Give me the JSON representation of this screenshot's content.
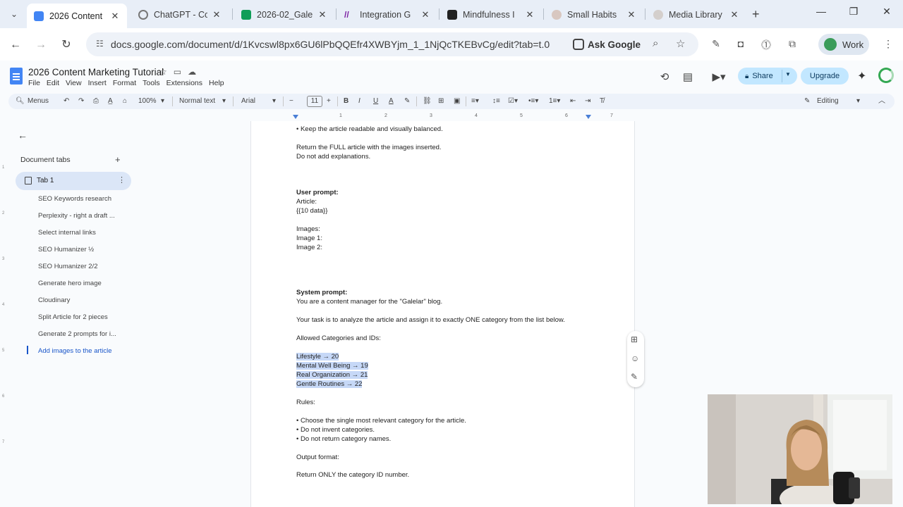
{
  "browser": {
    "tabs": [
      {
        "title": "2026 Content",
        "color": "#4285f4",
        "active": true
      },
      {
        "title": "ChatGPT - Co",
        "color": "#8f8f8f",
        "active": false
      },
      {
        "title": "2026-02_Gale",
        "color": "#0f9d58",
        "active": false
      },
      {
        "title": "Integration G",
        "color": "#7b1fa2",
        "active": false
      },
      {
        "title": "Mindfulness I",
        "color": "#222222",
        "active": false
      },
      {
        "title": "Small Habits",
        "color": "#d8c7c0",
        "active": false
      },
      {
        "title": "Media Library",
        "color": "#d4cfcc",
        "active": false
      }
    ],
    "url": "docs.google.com/document/d/1Kvcswl8px6GU6lPbQQEfr4XWBYjm_1_1NjQcTKEBvCg/edit?tab=t.0",
    "ask_google": "Ask Google",
    "profile": "Work"
  },
  "docs": {
    "title": "2026 Content Marketing Tutorial",
    "menu": [
      "File",
      "Edit",
      "View",
      "Insert",
      "Format",
      "Tools",
      "Extensions",
      "Help"
    ],
    "share": "Share",
    "upgrade": "Upgrade"
  },
  "toolbar": {
    "menus": "Menus",
    "zoom": "100%",
    "style": "Normal text",
    "font": "Arial",
    "font_size": "11",
    "mode": "Editing"
  },
  "sidebar": {
    "header": "Document tabs",
    "tab_name": "Tab 1",
    "outline": [
      "SEO Keywords research",
      "Perplexity - right a draft ...",
      "Select internal links",
      "SEO Humanizer ½",
      "SEO Humanizer 2/2",
      "Generate hero image",
      "Cloudinary",
      "Split Article for 2 pieces",
      "Generate 2 prompts for i...",
      "Add images to the article"
    ]
  },
  "ruler": [
    "1",
    "2",
    "3",
    "4",
    "5",
    "6",
    "7"
  ],
  "document": {
    "lines": [
      {
        "text": "• Keep the article readable and visually balanced."
      },
      {
        "text": "Return the FULL article with the images inserted."
      },
      {
        "text": "Do not add explanations."
      },
      {
        "text": "User prompt:"
      },
      {
        "text": "Article:"
      },
      {
        "text": "{{10 data}}"
      },
      {
        "text": "Images:"
      },
      {
        "text": "Image 1:"
      },
      {
        "text": "Image 2:"
      },
      {
        "text": "System prompt:"
      },
      {
        "text": "You are a content manager for the \"Galelar\" blog."
      },
      {
        "text": "Your task is to analyze the article and assign it to exactly ONE category from the list below."
      },
      {
        "text": "Allowed Categories and IDs:"
      },
      {
        "text": "Lifestyle → 20"
      },
      {
        "text": "Mental Well Being → 19"
      },
      {
        "text": "Real Organization → 21"
      },
      {
        "text": "Gentle Routines → 22"
      },
      {
        "text": "Rules:"
      },
      {
        "text": "• Choose the single most relevant category for the article."
      },
      {
        "text": "• Do not invent categories."
      },
      {
        "text": "• Do not return category names."
      },
      {
        "text": "Output format:"
      },
      {
        "text": "Return ONLY the category ID number."
      }
    ]
  }
}
